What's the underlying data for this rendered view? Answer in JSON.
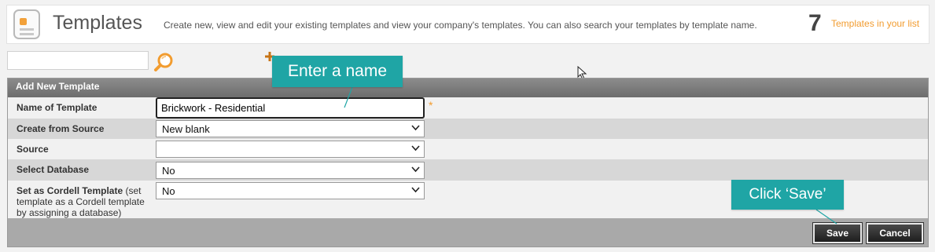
{
  "header": {
    "title": "Templates",
    "description": "Create new, view and edit your existing templates and view your company's templates. You can also search your templates by template name.",
    "count": "7",
    "count_label": "Templates in your list"
  },
  "search": {
    "value": "",
    "placeholder": ""
  },
  "panel": {
    "title": "Add New Template",
    "fields": [
      {
        "label": "Name of Template",
        "value": "Brickwork - Residential",
        "required_mark": "*"
      },
      {
        "label": "Create from Source",
        "value": "New blank"
      },
      {
        "label": "Source",
        "value": ""
      },
      {
        "label": "Select Database",
        "value": "No"
      },
      {
        "label": "Set as Cordell Template",
        "note": "(set template as a Cordell template by assigning a database)",
        "value": "No"
      }
    ],
    "buttons": {
      "save": "Save",
      "cancel": "Cancel"
    }
  },
  "callouts": {
    "name": "Enter a name",
    "save": "Click ‘Save’"
  },
  "colors": {
    "accent": "#f29c2f",
    "callout": "#1fa5a5",
    "panel_header": "#7a7a7a"
  },
  "icons": [
    "templates-app-icon",
    "search-icon",
    "add-icon",
    "mouse-cursor-icon",
    "chevron-down-icon"
  ]
}
